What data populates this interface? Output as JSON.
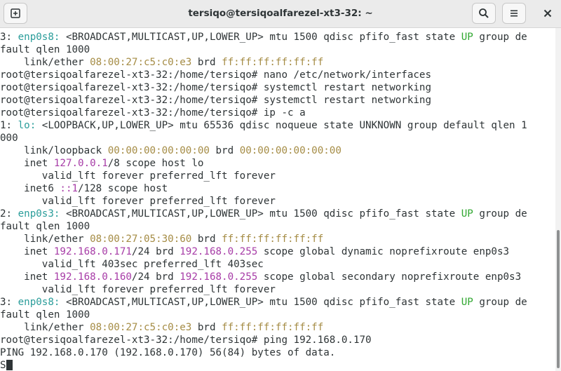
{
  "window": {
    "title": "tersiqo@tersiqoalfarezel-xt3-32: ~",
    "buttons": {
      "new_tab_icon": "new-tab-icon",
      "search_icon": "search-icon",
      "menu_icon": "hamburger-menu-icon",
      "close_icon": "close-icon"
    }
  },
  "colors": {
    "interface_name": "#2a9d9a",
    "state_up": "#32a832",
    "mac_address": "#a58c45",
    "ip_address": "#a73ca7",
    "text": "#2e3436",
    "titlebar": "#ebebeb"
  },
  "terminal": {
    "lines": [
      [
        [
          "3: ",
          ""
        ],
        [
          "enp0s8:",
          "c"
        ],
        [
          " <BROADCAST,MULTICAST,UP,LOWER_UP> mtu 1500 qdisc pfifo_fast state ",
          ""
        ],
        [
          "UP",
          "g"
        ],
        [
          " group de",
          ""
        ]
      ],
      [
        [
          "fault qlen 1000",
          ""
        ]
      ],
      [
        [
          "    link/ether ",
          ""
        ],
        [
          "08:00:27:c5:c0:e3",
          "y"
        ],
        [
          " brd ",
          ""
        ],
        [
          "ff:ff:ff:ff:ff:ff",
          "y"
        ]
      ],
      [
        [
          "root@tersiqoalfarezel-xt3-32:/home/tersiqo# nano /etc/network/interfaces",
          ""
        ]
      ],
      [
        [
          "root@tersiqoalfarezel-xt3-32:/home/tersiqo# systemctl restart networking",
          ""
        ]
      ],
      [
        [
          "root@tersiqoalfarezel-xt3-32:/home/tersiqo# systemctl restart networking",
          ""
        ]
      ],
      [
        [
          "root@tersiqoalfarezel-xt3-32:/home/tersiqo# ip -c a",
          ""
        ]
      ],
      [
        [
          "1: ",
          ""
        ],
        [
          "lo:",
          "c"
        ],
        [
          " <LOOPBACK,UP,LOWER_UP> mtu 65536 qdisc noqueue state UNKNOWN group default qlen 1",
          ""
        ]
      ],
      [
        [
          "000",
          ""
        ]
      ],
      [
        [
          "    link/loopback ",
          ""
        ],
        [
          "00:00:00:00:00:00",
          "y"
        ],
        [
          " brd ",
          ""
        ],
        [
          "00:00:00:00:00:00",
          "y"
        ]
      ],
      [
        [
          "    inet ",
          ""
        ],
        [
          "127.0.0.1",
          "m"
        ],
        [
          "/8 scope host lo",
          ""
        ]
      ],
      [
        [
          "       valid_lft forever preferred_lft forever",
          ""
        ]
      ],
      [
        [
          "    inet6 ",
          ""
        ],
        [
          "::1",
          "m"
        ],
        [
          "/128 scope host",
          ""
        ]
      ],
      [
        [
          "       valid_lft forever preferred_lft forever",
          ""
        ]
      ],
      [
        [
          "2: ",
          ""
        ],
        [
          "enp0s3:",
          "c"
        ],
        [
          " <BROADCAST,MULTICAST,UP,LOWER_UP> mtu 1500 qdisc pfifo_fast state ",
          ""
        ],
        [
          "UP",
          "g"
        ],
        [
          " group de",
          ""
        ]
      ],
      [
        [
          "fault qlen 1000",
          ""
        ]
      ],
      [
        [
          "    link/ether ",
          ""
        ],
        [
          "08:00:27:05:30:60",
          "y"
        ],
        [
          " brd ",
          ""
        ],
        [
          "ff:ff:ff:ff:ff:ff",
          "y"
        ]
      ],
      [
        [
          "    inet ",
          ""
        ],
        [
          "192.168.0.171",
          "m"
        ],
        [
          "/24 brd ",
          ""
        ],
        [
          "192.168.0.255",
          "m"
        ],
        [
          " scope global dynamic noprefixroute enp0s3",
          ""
        ]
      ],
      [
        [
          "       valid_lft 403sec preferred_lft 403sec",
          ""
        ]
      ],
      [
        [
          "    inet ",
          ""
        ],
        [
          "192.168.0.160",
          "m"
        ],
        [
          "/24 brd ",
          ""
        ],
        [
          "192.168.0.255",
          "m"
        ],
        [
          " scope global secondary noprefixroute enp0s3",
          ""
        ]
      ],
      [
        [
          "       valid_lft forever preferred_lft forever",
          ""
        ]
      ],
      [
        [
          "3: ",
          ""
        ],
        [
          "enp0s8:",
          "c"
        ],
        [
          " <BROADCAST,MULTICAST,UP,LOWER_UP> mtu 1500 qdisc pfifo_fast state ",
          ""
        ],
        [
          "UP",
          "g"
        ],
        [
          " group de",
          ""
        ]
      ],
      [
        [
          "fault qlen 1000",
          ""
        ]
      ],
      [
        [
          "    link/ether ",
          ""
        ],
        [
          "08:00:27:c5:c0:e3",
          "y"
        ],
        [
          " brd ",
          ""
        ],
        [
          "ff:ff:ff:ff:ff:ff",
          "y"
        ]
      ],
      [
        [
          "root@tersiqoalfarezel-xt3-32:/home/tersiqo# ping 192.168.0.170",
          ""
        ]
      ],
      [
        [
          "PING 192.168.0.170 (192.168.0.170) 56(84) bytes of data.",
          ""
        ]
      ],
      [
        [
          "S",
          ""
        ]
      ]
    ],
    "cursor_after_last_line": true
  },
  "scrollbar": {
    "visible_fraction": 0.4,
    "position": "bottom"
  }
}
